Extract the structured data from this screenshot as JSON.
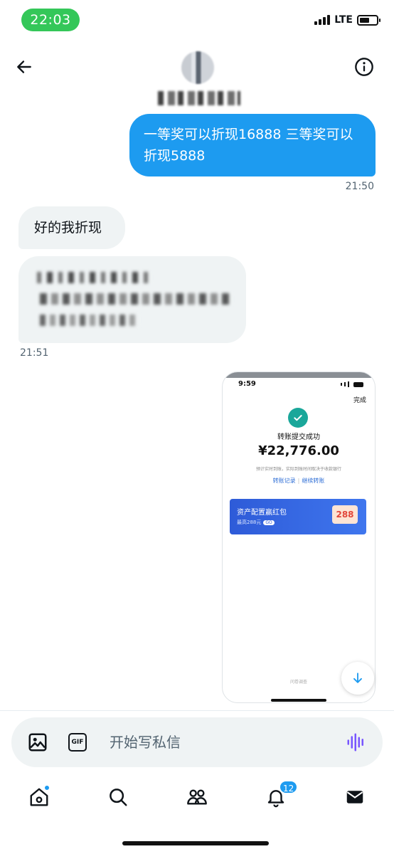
{
  "status_bar": {
    "time": "22:03",
    "network": "LTE"
  },
  "header": {
    "back_icon": "arrow-left-icon",
    "info_icon": "info-circle-icon"
  },
  "messages": [
    {
      "direction": "outgoing",
      "text": "一等奖可以折现16888 三等奖可以折现5888",
      "time": "21:50"
    },
    {
      "direction": "incoming",
      "text": "好的我折现"
    },
    {
      "direction": "incoming",
      "text": "",
      "redacted": true,
      "time": "21:51"
    }
  ],
  "attachment": {
    "time": "9:59",
    "done_label": "完成",
    "title": "转账提交成功",
    "amount": "¥22,776.00",
    "note": "预计实时到账，实际到账时间取决于收款银行",
    "link_records": "转账记录",
    "link_continue": "继续转账",
    "banner_title": "资产配置赢红包",
    "banner_sub": "最高288元",
    "banner_tag": "GO",
    "banner_badge": "288",
    "footer": "问卷调查"
  },
  "composer": {
    "placeholder": "开始写私信",
    "gif_label": "GIF"
  },
  "tabbar": {
    "items": [
      "home-icon",
      "search-icon",
      "communities-icon",
      "notifications-icon",
      "messages-icon"
    ],
    "notifications_badge": "12"
  },
  "colors": {
    "accent": "#1d9bf0",
    "bubble_incoming": "#eff3f4",
    "status_pill": "#34c759",
    "success": "#1aa79a"
  }
}
